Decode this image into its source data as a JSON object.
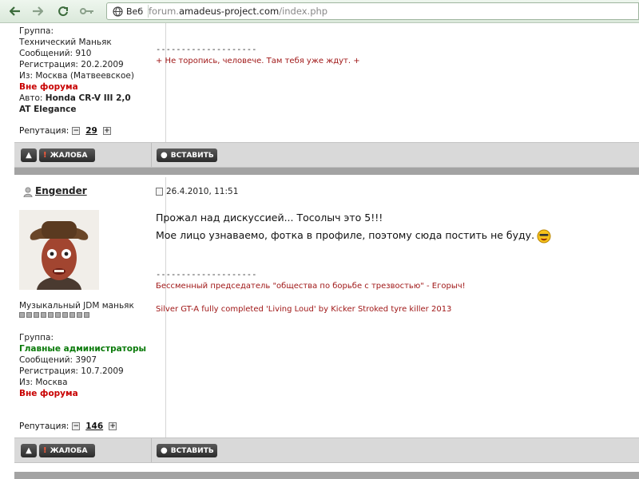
{
  "browser": {
    "chip_label": "Веб",
    "url_prefix": "forum.",
    "url_domain": "amadeus-project.com",
    "url_path": "/index.php"
  },
  "post1": {
    "info": {
      "group_label": "Группа:",
      "group_value": "Технический Маньяк",
      "messages": "Сообщений: 910",
      "registered": "Регистрация: 20.2.2009",
      "from": "Из: Москва (Матвеевское)",
      "status": "Вне форума",
      "auto_label": "Авто:",
      "auto_value_1": "Honda CR-V III 2,0",
      "auto_value_2": "AT Elegance"
    },
    "reputation_label": "Репутация:",
    "reputation_value": "29",
    "signature_dash": "--------------------",
    "signature_text": "+ Не торопись, человече. Там тебя уже ждут. +"
  },
  "buttons": {
    "report": "ЖАЛОБА",
    "insert": "ВСТАВИТЬ"
  },
  "post2": {
    "author": "Engender",
    "date": "26.4.2010, 11:51",
    "rank_title": "Музыкальный JDM маньяк",
    "info": {
      "group_label": "Группа:",
      "group_value": "Главные администраторы",
      "messages": "Сообщений: 3907",
      "registered": "Регистрация: 10.7.2009",
      "from": "Из: Москва",
      "status": "Вне форума"
    },
    "reputation_label": "Репутация:",
    "reputation_value": "146",
    "message_line_1": "Прожал над дискуссией... Тосолыч это 5!!!",
    "message_line_2": "Мое лицо узнаваемо, фотка в профиле, поэтому сюда постить не буду.",
    "signature_dash": "--------------------",
    "signature_line_1": "Бессменный председатель \"общества по борьбе с трезвостью\" - Егорыч!",
    "signature_line_2": "Silver GT-A fully completed 'Living Loud' by Kicker Stroked tyre killer 2013"
  }
}
